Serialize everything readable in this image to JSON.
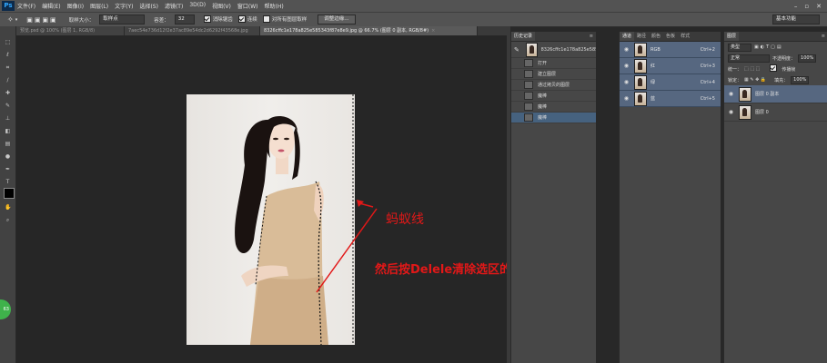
{
  "app": {
    "logo": "Ps"
  },
  "menubar": {
    "items": [
      "文件(F)",
      "编辑(E)",
      "图像(I)",
      "图层(L)",
      "文字(Y)",
      "选择(S)",
      "滤镜(T)",
      "3D(D)",
      "视图(V)",
      "窗口(W)",
      "帮助(H)"
    ],
    "window_controls": [
      "–",
      "▫",
      "✕"
    ]
  },
  "options": {
    "sample_size_label": "取样大小：",
    "sample_size_value": "取样点",
    "tolerance_label": "容差：",
    "tolerance_value": "32",
    "antialias_label": "消除锯齿",
    "contiguous_label": "连续",
    "all_layers_label": "对所有图层取样",
    "refine_edge_label": "调整边缘...",
    "workspace_label": "基本功能"
  },
  "tabs": [
    {
      "label": "预览.psd @ 100% (图层 1, RGB/8)",
      "active": false
    },
    {
      "label": "7aec54e736d12f2e37ac89e54dc2d6292f43568e.jpg",
      "active": false
    },
    {
      "label": "8326cffc1e178a825e585343f87e8e9.jpg @ 66.7% (图层 0 副本, RGB/8#)",
      "active": true
    }
  ],
  "history": {
    "title": "历史记录",
    "snapshot_label": "8326cffc1e178a825e585...",
    "items": [
      {
        "label": "打开",
        "selected": false
      },
      {
        "label": "建立图层",
        "selected": false
      },
      {
        "label": "通过拷贝的图层",
        "selected": false
      },
      {
        "label": "魔棒",
        "selected": false
      },
      {
        "label": "魔棒",
        "selected": false
      },
      {
        "label": "魔棒",
        "selected": true
      }
    ]
  },
  "channels": {
    "tabs": [
      "通道",
      "路径",
      "颜色",
      "色板",
      "样式"
    ],
    "rows": [
      {
        "name": "RGB",
        "shortcut": "Ctrl+2"
      },
      {
        "name": "红",
        "shortcut": "Ctrl+3"
      },
      {
        "name": "绿",
        "shortcut": "Ctrl+4"
      },
      {
        "name": "蓝",
        "shortcut": "Ctrl+5"
      }
    ]
  },
  "layers": {
    "title": "图层",
    "kind_label": "类型",
    "blend_mode": "正常",
    "opacity_label": "不透明度：",
    "opacity_value": "100%",
    "lock_label": "锁定：",
    "fill_label": "填充：",
    "fill_value": "100%",
    "row_label": "统一：",
    "propagate_label": "传播帧",
    "items": [
      {
        "name": "图层 0 副本",
        "selected": true
      },
      {
        "name": "图层 0",
        "selected": false
      }
    ]
  },
  "annotations": {
    "marching_ants": "蚂蚁线",
    "instruction": "然后按Delele清除选区的地方",
    "color": "#e21818"
  },
  "colors": {
    "accent": "#46627f",
    "selected_layer": "#566780",
    "badge": "#3fb24b"
  },
  "badge": {
    "text": "63"
  }
}
